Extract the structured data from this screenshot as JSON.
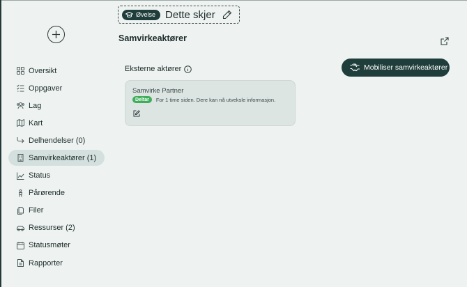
{
  "sidebar": {
    "add_icon": "plus-circle-icon",
    "items": [
      {
        "label": "Oversikt",
        "icon": "grid-icon"
      },
      {
        "label": "Oppgaver",
        "icon": "checklist-icon"
      },
      {
        "label": "Lag",
        "icon": "team-icon"
      },
      {
        "label": "Kart",
        "icon": "map-icon"
      },
      {
        "label": "Delhendelser (0)",
        "icon": "subevent-arrow-icon"
      },
      {
        "label": "Samvirkeaktører (1)",
        "icon": "building-icon",
        "active": true
      },
      {
        "label": "Status",
        "icon": "chart-line-icon"
      },
      {
        "label": "Pårørende",
        "icon": "person-icon"
      },
      {
        "label": "Filer",
        "icon": "files-icon"
      },
      {
        "label": "Ressurser (2)",
        "icon": "car-icon"
      },
      {
        "label": "Statusmøter",
        "icon": "calendar-icon"
      },
      {
        "label": "Rapporter",
        "icon": "document-icon"
      }
    ]
  },
  "header": {
    "badge_label": "Øvelse",
    "badge_icon": "graduation-cap-icon",
    "title": "Dette skjer",
    "edit_icon": "pencil-icon"
  },
  "main": {
    "page_title": "Samvirkeaktører",
    "external_link_icon": "external-link-icon",
    "mobilize_button_label": "Mobiliser samvirkeaktører",
    "mobilize_icon": "handshake-icon",
    "section_label": "Eksterne aktører",
    "info_icon": "info-icon",
    "card": {
      "name": "Samvirke Partner",
      "status": "Deltar",
      "description": "For 1 time siden. Dere kan nå utveksle informasjon.",
      "edit_icon": "edit-square-icon"
    }
  },
  "colors": {
    "background": "#eef3f1",
    "primary": "#1f3d3b",
    "active_nav": "#d4e0dd",
    "status_green": "#3fae5a",
    "card_bg": "#dde5e3"
  }
}
